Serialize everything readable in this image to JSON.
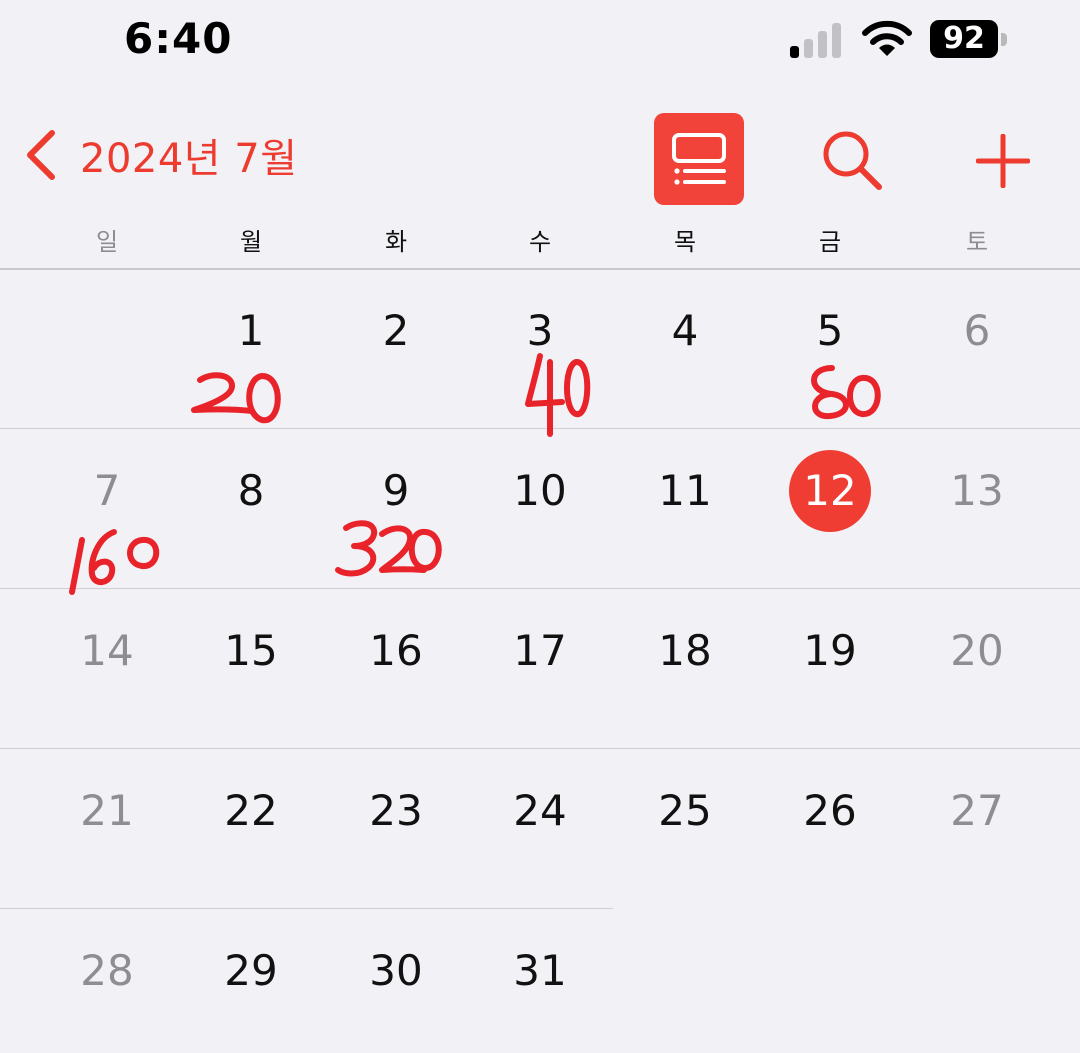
{
  "status_bar": {
    "time": "6:40",
    "battery": "92",
    "icons": [
      "cellular-signal-icon",
      "wifi-icon",
      "battery-icon"
    ]
  },
  "nav": {
    "title": "2024년 7월",
    "back_icon": "chevron-left-icon",
    "list_view_icon": "list-view-icon",
    "search_icon": "search-icon",
    "add_icon": "plus-icon"
  },
  "colors": {
    "accent": "#ee3b30",
    "weekend_text": "#8d8d92",
    "background": "#f2f2f6",
    "today_fill": "#f03d33"
  },
  "weekdays": [
    "일",
    "월",
    "화",
    "수",
    "목",
    "금",
    "토"
  ],
  "today": "12",
  "weeks": [
    [
      "",
      "1",
      "2",
      "3",
      "4",
      "5",
      "6"
    ],
    [
      "7",
      "8",
      "9",
      "10",
      "11",
      "12",
      "13"
    ],
    [
      "14",
      "15",
      "16",
      "17",
      "18",
      "19",
      "20"
    ],
    [
      "21",
      "22",
      "23",
      "24",
      "25",
      "26",
      "27"
    ],
    [
      "28",
      "29",
      "30",
      "31",
      "",
      "",
      ""
    ]
  ],
  "handwritten_notes": [
    {
      "day": "1",
      "text": "20"
    },
    {
      "day": "3",
      "text": "40"
    },
    {
      "day": "5",
      "text": "80"
    },
    {
      "day": "7",
      "text": "160"
    },
    {
      "day": "9",
      "text": "320"
    }
  ]
}
